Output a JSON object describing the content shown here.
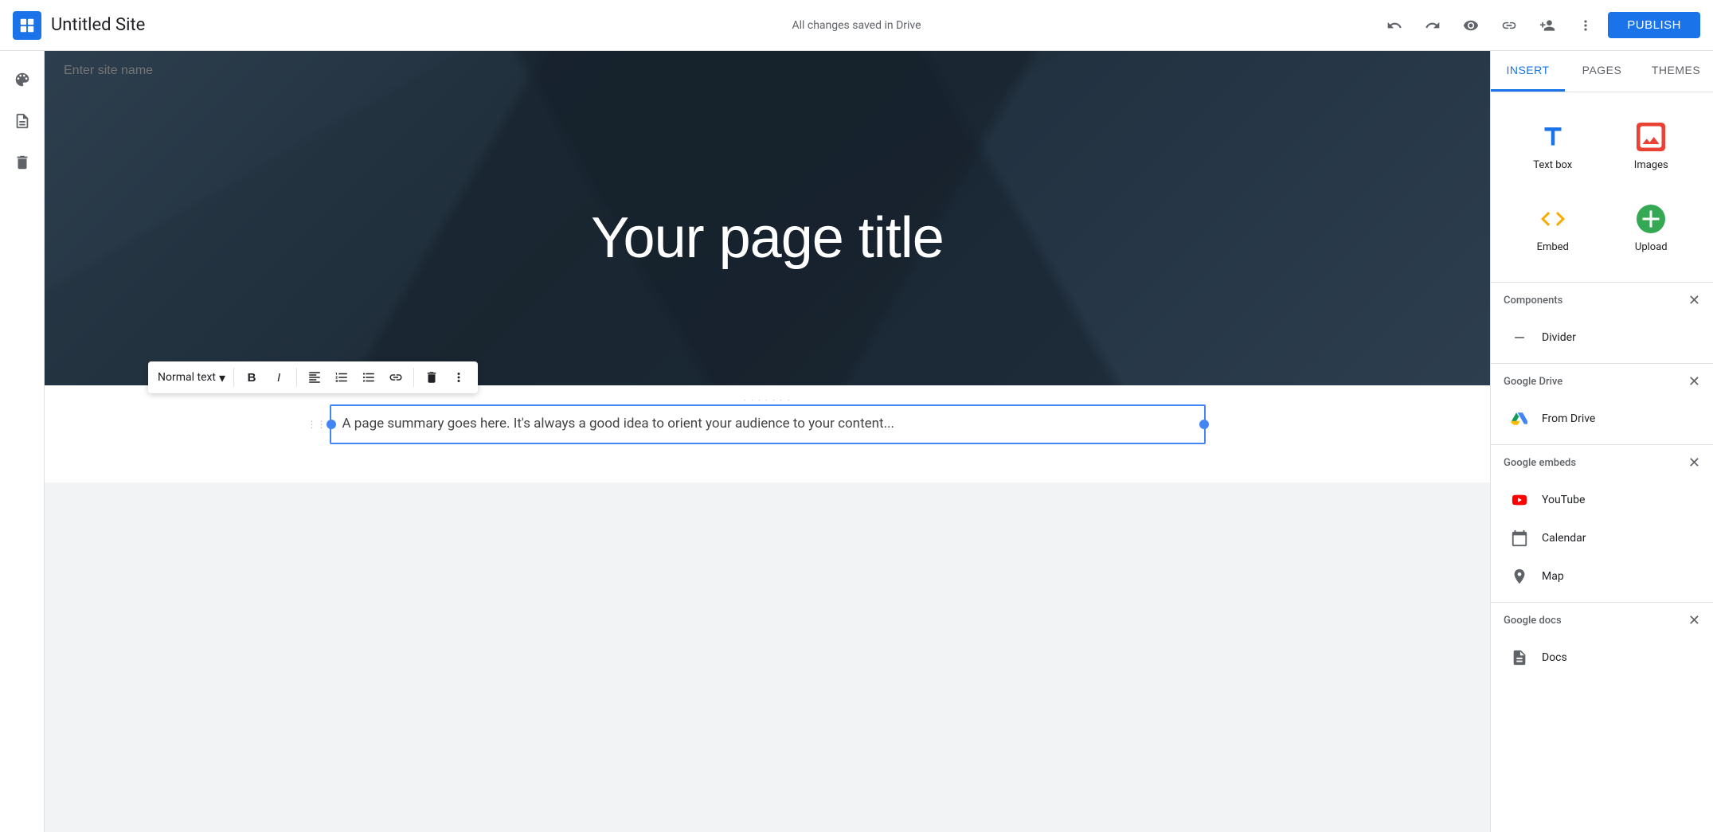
{
  "header": {
    "logo_label": "Google Sites",
    "title": "Untitled Site",
    "status": "All changes saved in Drive",
    "publish_label": "PUBLISH"
  },
  "tabs": {
    "insert": "INSERT",
    "pages": "PAGES",
    "themes": "THEMES"
  },
  "hero": {
    "site_name_placeholder": "Enter site name",
    "page_title": "Your page title"
  },
  "toolbar": {
    "format_label": "Normal text",
    "bold": "B",
    "italic": "I"
  },
  "text_block": {
    "content": "A page summary goes here. It's always a good idea to orient your audience to your content..."
  },
  "insert_panel": {
    "items": [
      {
        "id": "text-box",
        "label": "Text box",
        "icon": "text-box-icon"
      },
      {
        "id": "images",
        "label": "Images",
        "icon": "images-icon"
      },
      {
        "id": "embed",
        "label": "Embed",
        "icon": "embed-icon"
      },
      {
        "id": "upload",
        "label": "Upload",
        "icon": "upload-icon"
      }
    ],
    "sections": [
      {
        "id": "components",
        "label": "Components",
        "collapsed": false,
        "items": [
          {
            "id": "divider",
            "label": "Divider",
            "icon": "divider-icon"
          }
        ]
      },
      {
        "id": "google-drive",
        "label": "Google Drive",
        "collapsed": false,
        "items": [
          {
            "id": "from-drive",
            "label": "From Drive",
            "icon": "drive-icon"
          }
        ]
      },
      {
        "id": "google-embeds",
        "label": "Google embeds",
        "collapsed": false,
        "items": [
          {
            "id": "youtube",
            "label": "YouTube",
            "icon": "youtube-icon"
          },
          {
            "id": "calendar",
            "label": "Calendar",
            "icon": "calendar-icon"
          },
          {
            "id": "map",
            "label": "Map",
            "icon": "map-icon"
          }
        ]
      },
      {
        "id": "google-docs",
        "label": "Google docs",
        "collapsed": false,
        "items": [
          {
            "id": "docs",
            "label": "Docs",
            "icon": "docs-icon"
          }
        ]
      }
    ]
  }
}
